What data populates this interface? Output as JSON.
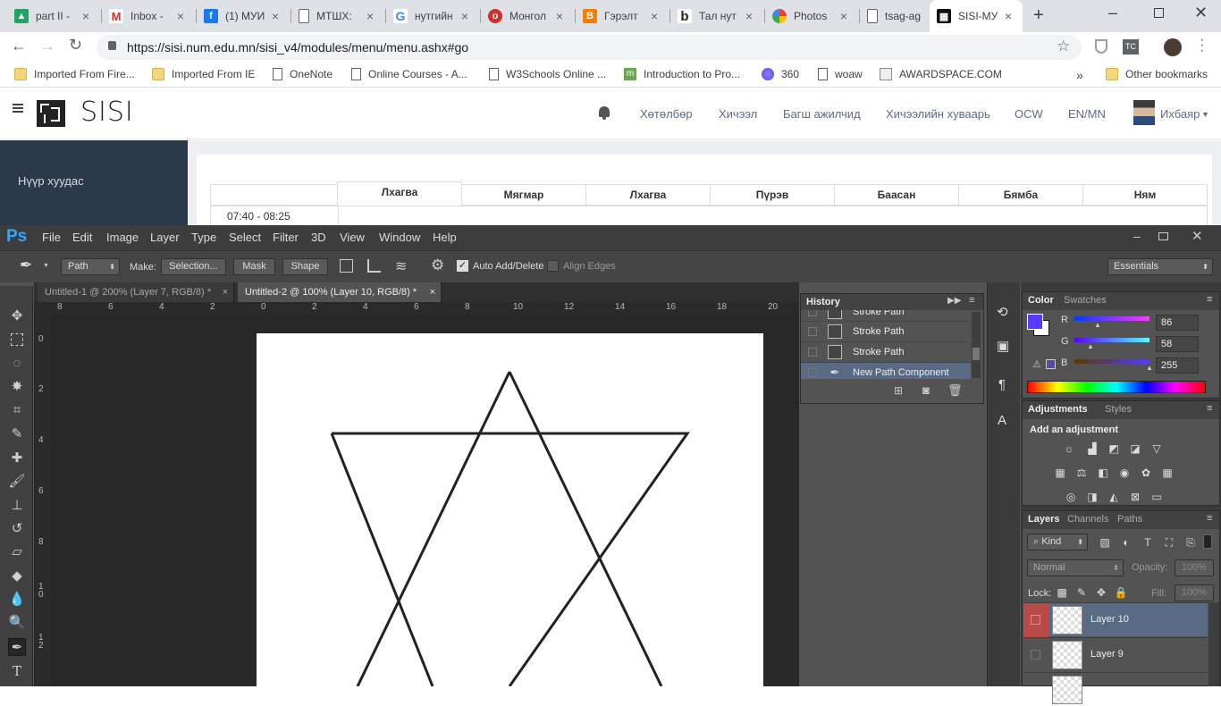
{
  "browser": {
    "tabs": [
      {
        "title": "part II -",
        "icon": "google-drive-icon",
        "color": "#1fa463"
      },
      {
        "title": "Inbox -",
        "icon": "gmail-icon",
        "color": "#d93025"
      },
      {
        "title": "(1) МУИ",
        "icon": "facebook-icon",
        "color": "#1877f2"
      },
      {
        "title": "МТШХ:",
        "icon": "document-icon",
        "color": "#5f6368"
      },
      {
        "title": "нутгийн",
        "icon": "google-icon",
        "color": "#4285f4"
      },
      {
        "title": "Монгол",
        "icon": "opera-icon",
        "color": "#d32f2f"
      },
      {
        "title": "Гэрэлт",
        "icon": "blogger-icon",
        "color": "#f57d00"
      },
      {
        "title": "Тал нут",
        "icon": "bold-b-icon",
        "color": "#222222"
      },
      {
        "title": "Photos",
        "icon": "photos-icon",
        "color": "#ea4335"
      },
      {
        "title": "tsag-ag",
        "icon": "document-icon",
        "color": "#5f6368"
      },
      {
        "title": "SISI-МУ",
        "icon": "sisi-icon",
        "color": "#111111",
        "active": true
      }
    ],
    "url": "https://sisi.num.edu.mn/sisi_v4/modules/menu/menu.ashx#go",
    "bookmarks": [
      {
        "label": "Imported From Fire...",
        "type": "folder"
      },
      {
        "label": "Imported From IE",
        "type": "folder"
      },
      {
        "label": "OneNote",
        "type": "page"
      },
      {
        "label": "Online Courses - A...",
        "type": "page"
      },
      {
        "label": "W3Schools Online ...",
        "type": "page"
      },
      {
        "label": "Introduction to Pro...",
        "type": "m-icon"
      },
      {
        "label": "360",
        "type": "circle"
      },
      {
        "label": "woaw",
        "type": "page"
      },
      {
        "label": "AWARDSPACE.COM",
        "type": "site"
      }
    ],
    "other_bookmarks": "Other bookmarks",
    "overflow": "»"
  },
  "sisi": {
    "logo": "SISI",
    "nav": [
      "Хөтөлбөр",
      "Хичээл",
      "Багш ажилчид",
      "Хичээлийн хуваарь",
      "OCW",
      "EN/MN"
    ],
    "user": "Ихбаяр",
    "sidebar_item": "Нүүр хуудас",
    "days": [
      "Лхагва",
      "Мягмар",
      "Лхагва",
      "Пүрэв",
      "Баасан",
      "Бямба",
      "Ням"
    ],
    "time": "07:40 - 08:25"
  },
  "photoshop": {
    "logo": "Ps",
    "menu": [
      "File",
      "Edit",
      "Image",
      "Layer",
      "Type",
      "Select",
      "Filter",
      "3D",
      "View",
      "Window",
      "Help"
    ],
    "options": {
      "mode": "Path",
      "make_label": "Make:",
      "selection_btn": "Selection...",
      "mask_btn": "Mask",
      "shape_btn": "Shape",
      "auto_add_delete": "Auto Add/Delete",
      "align_edges": "Align Edges",
      "workspace": "Essentials"
    },
    "doc_tabs": [
      "Untitled-1 @ 200% (Layer 7, RGB/8) *",
      "Untitled-2 @ 100% (Layer 10, RGB/8) *"
    ],
    "ruler_h": [
      "8",
      "6",
      "4",
      "2",
      "0",
      "2",
      "4",
      "6",
      "8",
      "10",
      "12",
      "14",
      "16",
      "18",
      "20"
    ],
    "ruler_v": [
      "0",
      "2",
      "4",
      "6",
      "8",
      "1\n0",
      "1\n2"
    ],
    "history": {
      "title": "History",
      "items": [
        "Stroke Path",
        "Stroke Path",
        "Stroke Path",
        "New Path Component"
      ]
    },
    "color_panel": {
      "tabs": [
        "Color",
        "Swatches"
      ],
      "r": "86",
      "g": "58",
      "b": "255",
      "foreground": "#563aff"
    },
    "adjustments": {
      "tabs": [
        "Adjustments",
        "Styles"
      ],
      "heading": "Add an adjustment"
    },
    "layers": {
      "tabs": [
        "Layers",
        "Channels",
        "Paths"
      ],
      "kind": "Kind",
      "blend": "Normal",
      "opacity_label": "Opacity:",
      "opacity": "100%",
      "lock_label": "Lock:",
      "fill_label": "Fill:",
      "fill": "100%",
      "items": [
        "Layer 10",
        "Layer 9"
      ]
    }
  }
}
